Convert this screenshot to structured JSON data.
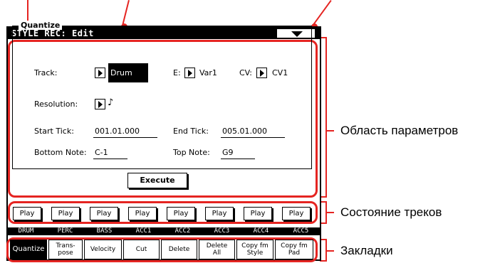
{
  "window": {
    "title": "STYLE REC: Edit"
  },
  "quantize": {
    "group_title": "Quantize",
    "track_label": "Track:",
    "track_value": "Drum",
    "e_label": "E:",
    "e_value": "Var1",
    "cv_label": "CV:",
    "cv_value": "CV1",
    "resolution_label": "Resolution:",
    "resolution_value": "♪",
    "start_tick_label": "Start Tick:",
    "start_tick_value": "001.01.000",
    "end_tick_label": "End Tick:",
    "end_tick_value": "005.01.000",
    "bottom_note_label": "Bottom Note:",
    "bottom_note_value": "C-1",
    "top_note_label": "Top Note:",
    "top_note_value": "G9",
    "execute_label": "Execute"
  },
  "tracks": [
    {
      "name": "DRUM",
      "status": "Play"
    },
    {
      "name": "PERC",
      "status": "Play"
    },
    {
      "name": "BASS",
      "status": "Play"
    },
    {
      "name": "ACC1",
      "status": "Play"
    },
    {
      "name": "ACC2",
      "status": "Play"
    },
    {
      "name": "ACC3",
      "status": "Play"
    },
    {
      "name": "ACC4",
      "status": "Play"
    },
    {
      "name": "ACC5",
      "status": "Play"
    }
  ],
  "tabs": [
    {
      "line1": "Quantize",
      "line2": ""
    },
    {
      "line1": "Trans-",
      "line2": "pose"
    },
    {
      "line1": "Velocity",
      "line2": ""
    },
    {
      "line1": "Cut",
      "line2": ""
    },
    {
      "line1": "Delete",
      "line2": ""
    },
    {
      "line1": "Delete",
      "line2": "All"
    },
    {
      "line1": "Copy fm",
      "line2": "Style"
    },
    {
      "line1": "Copy fm",
      "line2": "Pad"
    }
  ],
  "annotations": {
    "params_area": "Область параметров",
    "track_status": "Состояние треков",
    "tabs": "Закладки"
  },
  "colors": {
    "callout": "#e52421"
  }
}
